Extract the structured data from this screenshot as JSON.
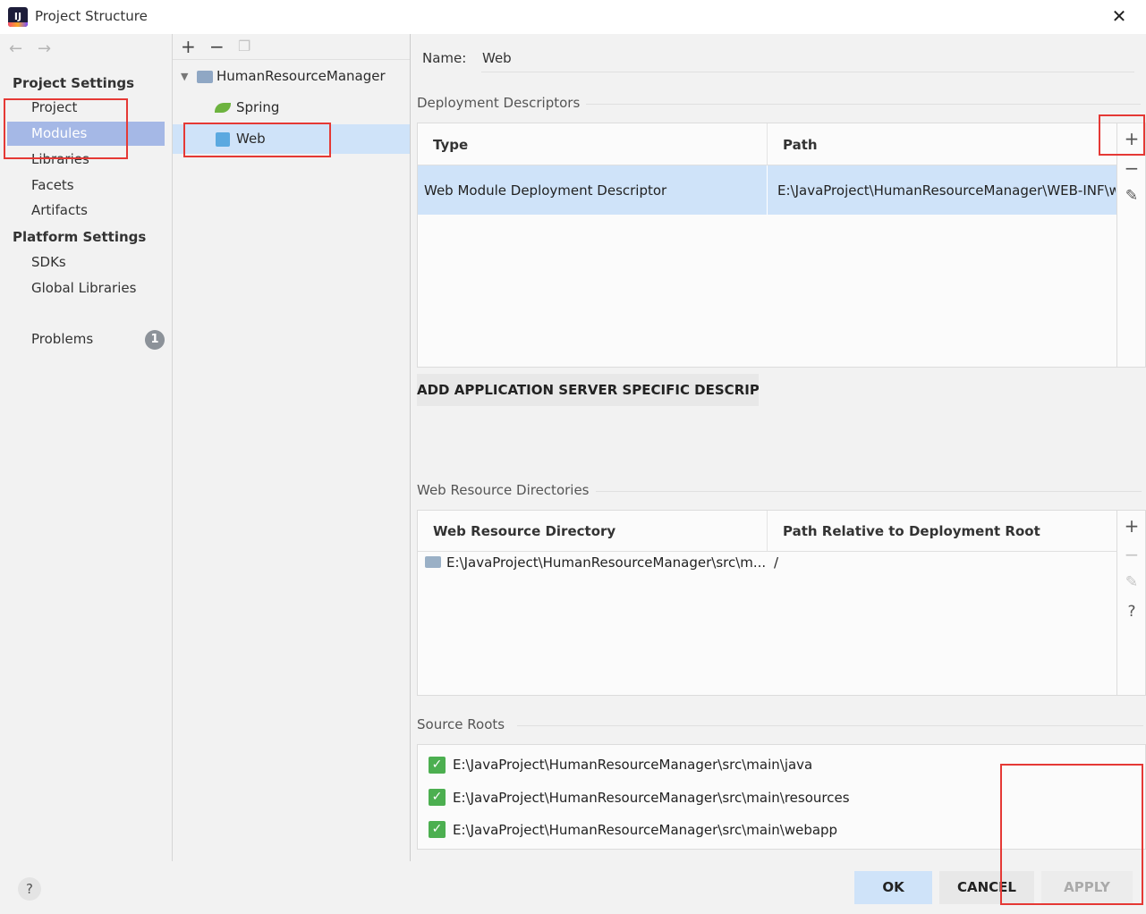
{
  "window": {
    "title": "Project Structure"
  },
  "nav": {
    "project_settings": "Project Settings",
    "project_items": [
      "Project",
      "Modules",
      "Libraries",
      "Facets",
      "Artifacts"
    ],
    "platform_settings": "Platform Settings",
    "platform_items": [
      "SDKs",
      "Global Libraries"
    ],
    "problems": "Problems",
    "problems_count": "1"
  },
  "tree": {
    "root": "HumanResourceManager",
    "children": [
      "Spring",
      "Web"
    ]
  },
  "name_field": {
    "label": "Name:",
    "value": "Web"
  },
  "deployment": {
    "title": "Deployment Descriptors",
    "columns": [
      "Type",
      "Path"
    ],
    "rows": [
      {
        "type": "Web Module Deployment Descriptor",
        "path": "E:\\JavaProject\\HumanResourceManager\\WEB-INF\\w"
      }
    ],
    "add_server_button": "ADD APPLICATION SERVER SPECIFIC DESCRIPTOR.."
  },
  "web_resources": {
    "title": "Web Resource Directories",
    "columns": [
      "Web Resource Directory",
      "Path Relative to Deployment Root"
    ],
    "rows": [
      {
        "directory": "E:\\JavaProject\\HumanResourceManager\\src\\m...",
        "relative": "/"
      }
    ]
  },
  "source_roots": {
    "title": "Source Roots",
    "items": [
      "E:\\JavaProject\\HumanResourceManager\\src\\main\\java",
      "E:\\JavaProject\\HumanResourceManager\\src\\main\\resources",
      "E:\\JavaProject\\HumanResourceManager\\src\\main\\webapp"
    ]
  },
  "buttons": {
    "ok": "OK",
    "cancel": "CANCEL",
    "apply": "APPLY",
    "help": "?"
  },
  "colors": {
    "selection": "#a5b8e6",
    "tree_selection": "#cfe3f9",
    "highlight": "#e53935",
    "check": "#4caf50"
  }
}
